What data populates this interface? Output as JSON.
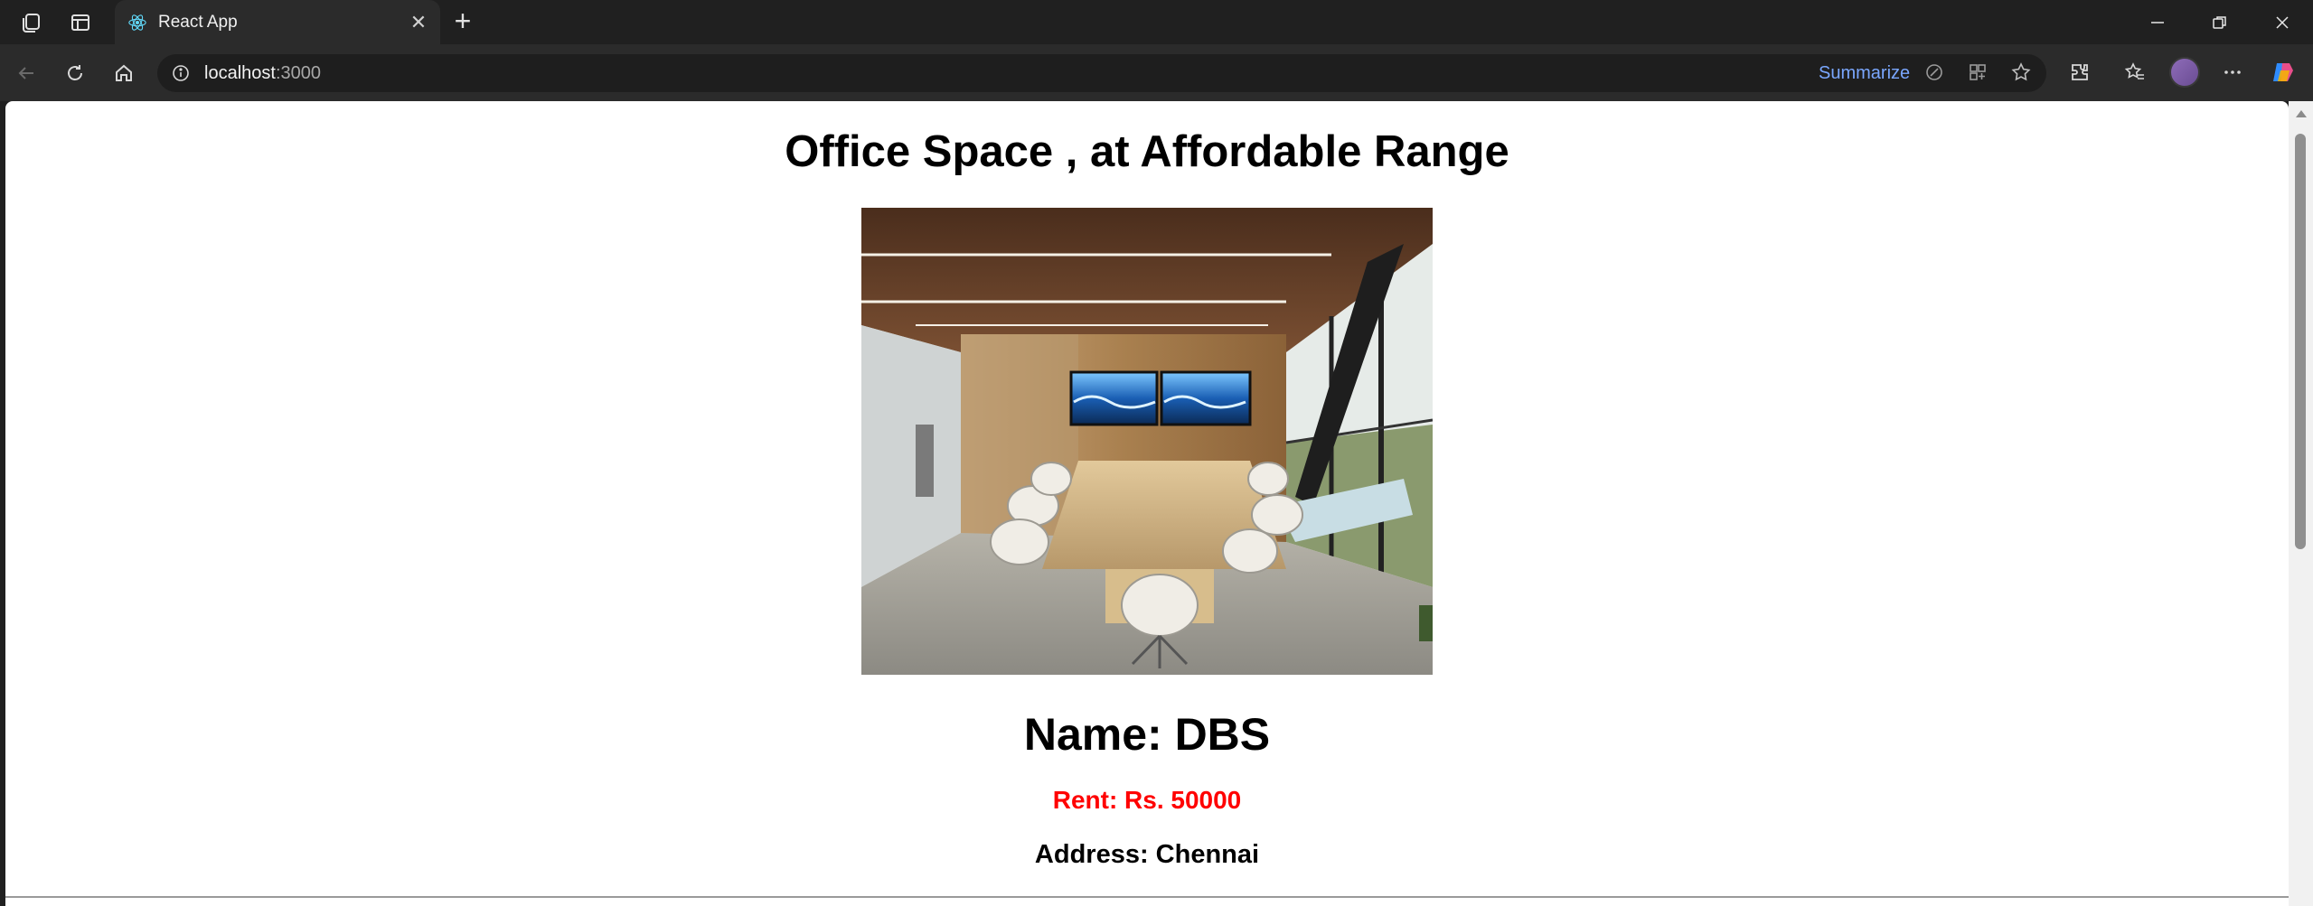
{
  "browser": {
    "tab_title": "React App",
    "url_host": "localhost",
    "url_port": ":3000",
    "summarize_label": "Summarize"
  },
  "page": {
    "heading": "Office Space , at Affordable Range",
    "image_alt": "conference-room-photo",
    "name": "Name: DBS",
    "rent": "Rent: Rs. 50000",
    "address": "Address: Chennai",
    "rent_color": "#ff0000"
  },
  "icons": [
    "workspaces-icon",
    "tab-actions-icon",
    "react-favicon",
    "close-tab-icon",
    "new-tab-icon",
    "minimize-icon",
    "restore-icon",
    "close-window-icon",
    "back-icon",
    "refresh-icon",
    "home-icon",
    "info-icon",
    "read-aloud-icon",
    "apps-icon",
    "favorite-star-icon",
    "extensions-icon",
    "favorites-icon",
    "profile-avatar",
    "more-icon",
    "copilot-icon"
  ]
}
